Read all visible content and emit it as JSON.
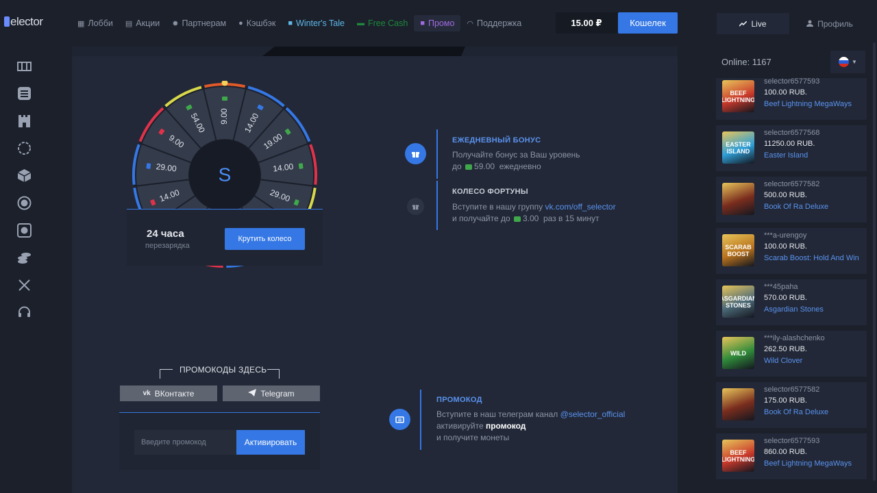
{
  "logo": {
    "text": "elector"
  },
  "nav": [
    {
      "label": "Лобби",
      "icon": "grid-icon"
    },
    {
      "label": "Акции",
      "icon": "list-icon"
    },
    {
      "label": "Партнерам",
      "icon": "gear-icon"
    },
    {
      "label": "Кэшбэк",
      "icon": "user-icon"
    },
    {
      "label": "Winter's Tale",
      "icon": "gift-icon"
    },
    {
      "label": "Free Cash",
      "icon": "cash-icon"
    },
    {
      "label": "Промо",
      "icon": "gift-icon"
    },
    {
      "label": "Поддержка",
      "icon": "headset-icon"
    }
  ],
  "balance": "15.00 ₽",
  "wallet_label": "Кошелек",
  "live_label": "Live",
  "profile_label": "Профиль",
  "online": "Online: 1167",
  "wheel": {
    "center": "S",
    "segments": [
      "9.00",
      "14.00",
      "19.00",
      "14.00",
      "29.00",
      "",
      "",
      "",
      "",
      "14.00",
      "29.00",
      "9.00",
      "54.00"
    ],
    "cooldown": "24 часа",
    "cooldown_sub": "перезарядка",
    "spin_label": "Крутить колесо"
  },
  "daily": {
    "title": "ЕЖЕДНЕВНЫЙ БОНУС",
    "line1": "Получайте бонус за Ваш уровень",
    "line2_pre": "до",
    "amount": "59.00",
    "line2_post": "ежедневно"
  },
  "fortune": {
    "title": "КОЛЕСО ФОРТУНЫ",
    "line1_pre": "Вступите в нашу группу",
    "link": "vk.com/off_selector",
    "line2_pre": "и получайте до",
    "amount": "3.00",
    "line2_post": "раз в 15 минут"
  },
  "promo_info": {
    "title": "ПРОМОКОД",
    "line1_pre": "Вступите в наш телеграм канал",
    "link": "@selector_official",
    "line2_pre": "активируйте",
    "line2_bold": "промокод",
    "line3": "и получите монеты"
  },
  "promo": {
    "heading": "ПРОМОКОДЫ ЗДЕСЬ",
    "vk_label": "ВКонтакте",
    "tg_label": "Telegram",
    "placeholder": "Введите промокод",
    "activate_label": "Активировать"
  },
  "feed": [
    {
      "user": "selector6577593",
      "amount": "100.00 RUB.",
      "game": "Beef Lightning MegaWays",
      "thumb": "BEEF LIGHTNING",
      "color": "#c9392b"
    },
    {
      "user": "selector6577568",
      "amount": "11250.00 RUB.",
      "game": "Easter Island",
      "thumb": "EASTER ISLAND",
      "color": "#2f9fd8"
    },
    {
      "user": "selector6577582",
      "amount": "500.00 RUB.",
      "game": "Book Of Ra Deluxe",
      "thumb": "",
      "color": "#7a2d1e"
    },
    {
      "user": "***a-urengoy",
      "amount": "100.00 RUB.",
      "game": "Scarab Boost: Hold And Win",
      "thumb": "SCARAB BOOST",
      "color": "#b8721d"
    },
    {
      "user": "***45paha",
      "amount": "570.00 RUB.",
      "game": "Asgardian Stones",
      "thumb": "ASGARDIAN STONES",
      "color": "#4c6a78"
    },
    {
      "user": "***ily-alashchenko",
      "amount": "262.50 RUB.",
      "game": "Wild Clover",
      "thumb": "WILD",
      "color": "#2f8a3a"
    },
    {
      "user": "selector6577582",
      "amount": "175.00 RUB.",
      "game": "Book Of Ra Deluxe",
      "thumb": "",
      "color": "#7a2d1e"
    },
    {
      "user": "selector6577593",
      "amount": "860.00 RUB.",
      "game": "Beef Lightning MegaWays",
      "thumb": "BEEF LIGHTNING",
      "color": "#c9392b"
    }
  ]
}
